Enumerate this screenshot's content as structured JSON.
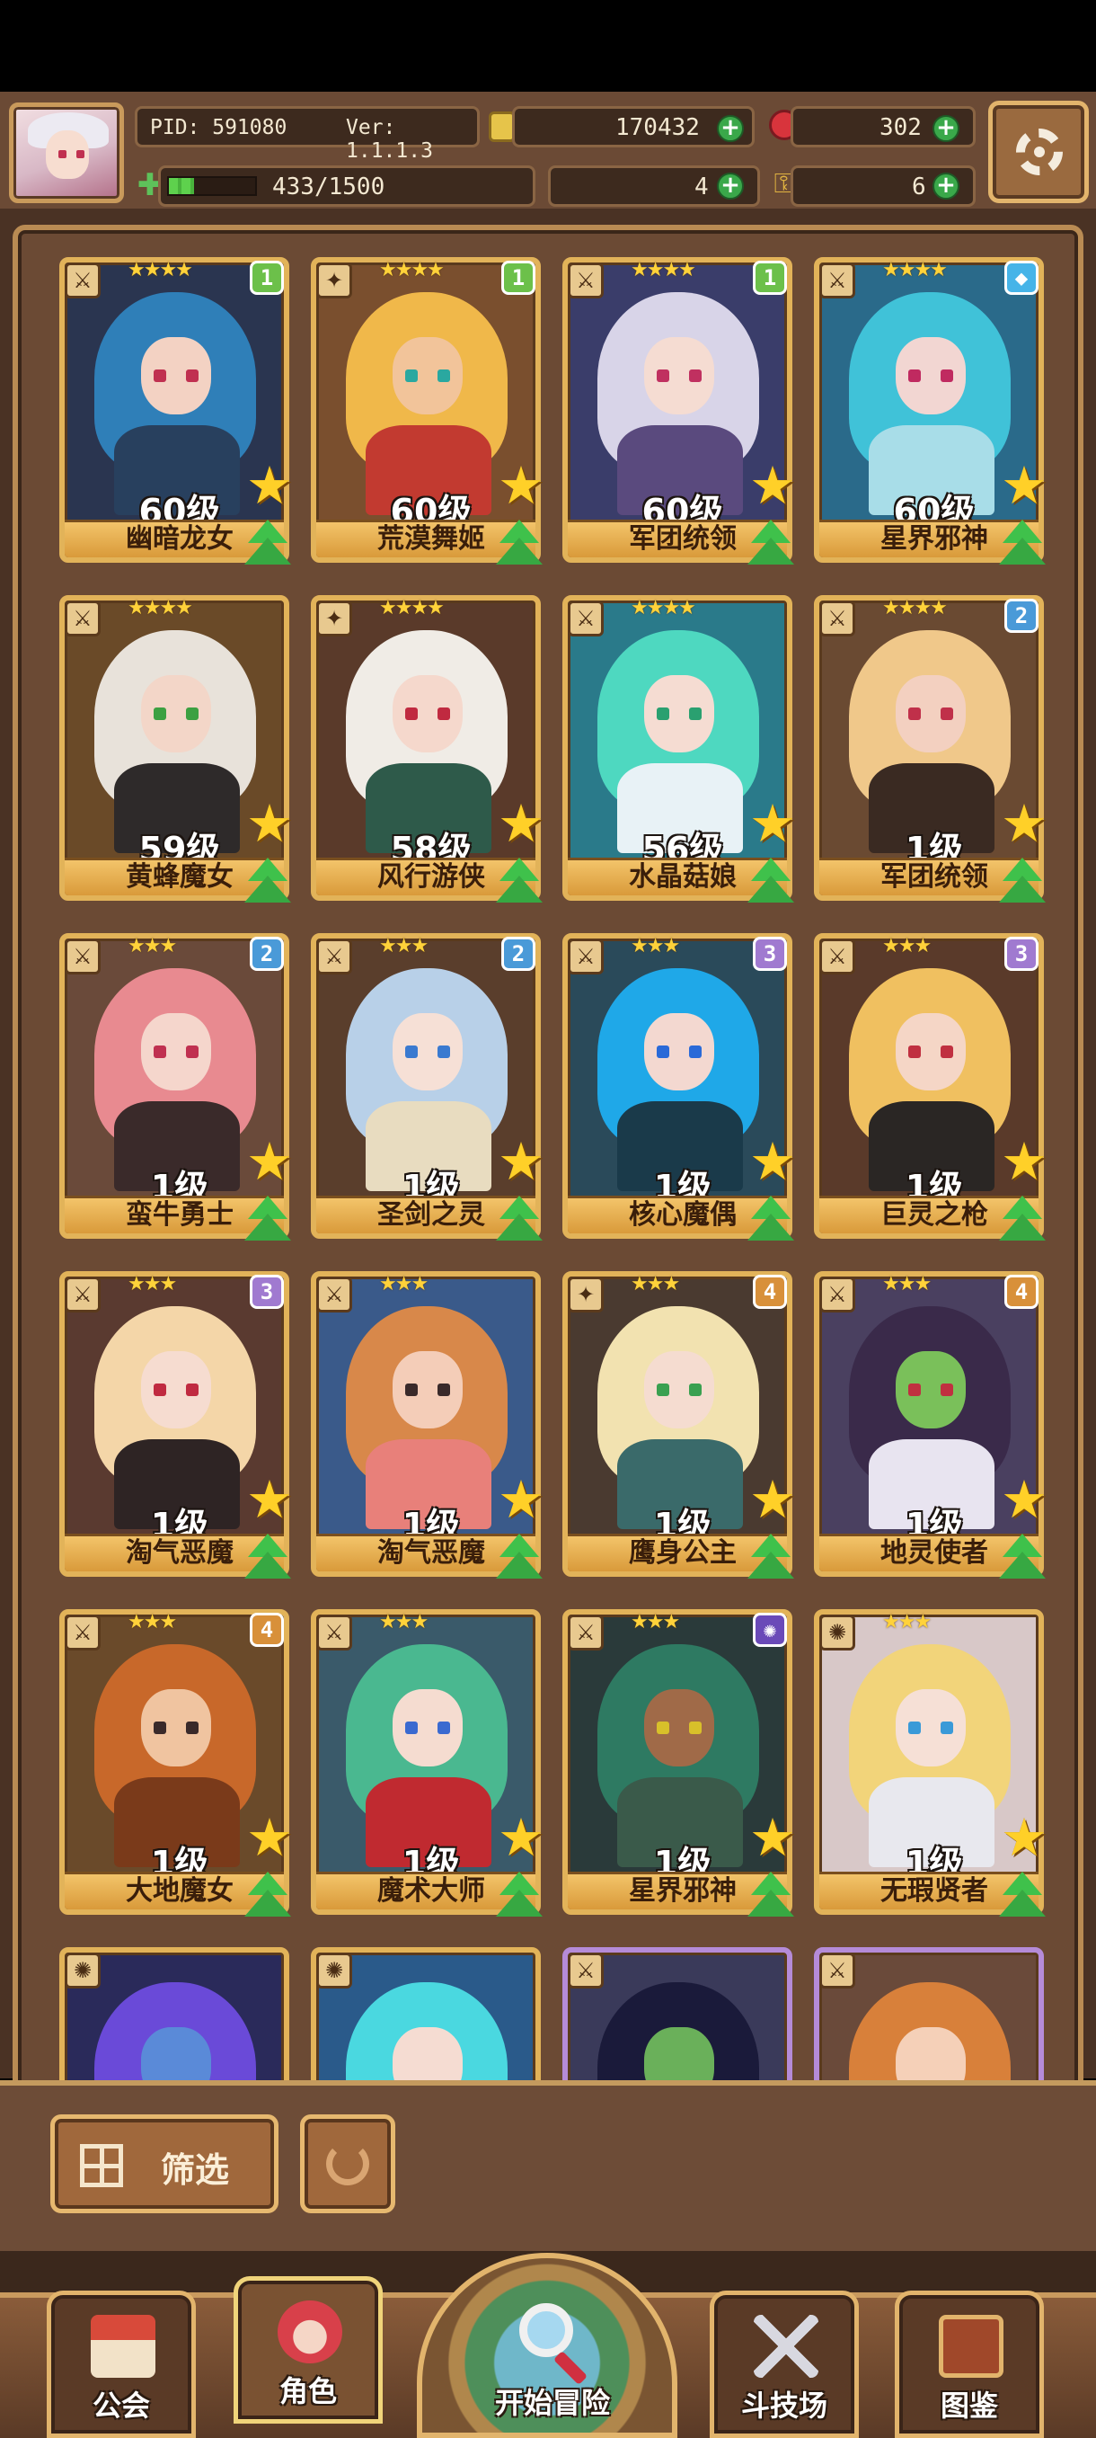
{
  "header": {
    "pid": "PID: 591080",
    "version": "Ver: 1.1.1.3",
    "gold": "170432",
    "gems": "302",
    "energy": "433/1500",
    "energy_fraction": 0.289,
    "clovers": "4",
    "keys": "6"
  },
  "cards": [
    {
      "level": "60级",
      "name": "幽暗龙女",
      "stars": "★★★★",
      "rank": "1",
      "rank_color": "#6cc04a",
      "type": "⚔",
      "hair": "#2f7fb8",
      "skin": "#f3d2c3",
      "bg": "#2a3550",
      "eye": "#c03050",
      "outfit": "#28405e"
    },
    {
      "level": "60级",
      "name": "荒漠舞姬",
      "stars": "★★★★",
      "rank": "1",
      "rank_color": "#6cc04a",
      "type": "✦",
      "hair": "#f0b84a",
      "skin": "#f2c49a",
      "bg": "#7a4f2e",
      "eye": "#2aa8a0",
      "outfit": "#c23a30"
    },
    {
      "level": "60级",
      "name": "军团统领",
      "stars": "★★★★",
      "rank": "1",
      "rank_color": "#6cc04a",
      "type": "⚔",
      "hair": "#d8d4e8",
      "skin": "#f5dcd2",
      "bg": "#3a3d6a",
      "eye": "#c03060",
      "outfit": "#5a4a7e"
    },
    {
      "level": "60级",
      "name": "星界邪神",
      "stars": "★★★★",
      "rank": "◆",
      "rank_color": "#46b4e8",
      "type": "⚔",
      "hair": "#40c2d8",
      "skin": "#f2d6d2",
      "bg": "#2a6a8a",
      "eye": "#c02a60",
      "outfit": "#a8dde8"
    },
    {
      "level": "59级",
      "name": "黄蜂魔女",
      "stars": "★★★★",
      "rank": "",
      "rank_color": "",
      "type": "⚔",
      "hair": "#e8e2da",
      "skin": "#f3d6c8",
      "bg": "#6a4a28",
      "eye": "#3ca042",
      "outfit": "#2e2a2a"
    },
    {
      "level": "58级",
      "name": "风行游侠",
      "stars": "★★★★",
      "rank": "",
      "rank_color": "",
      "type": "✦",
      "hair": "#f0ece6",
      "skin": "#f5d8cc",
      "bg": "#5a3a2a",
      "eye": "#c02a40",
      "outfit": "#2e5a4a"
    },
    {
      "level": "56级",
      "name": "水晶菇娘",
      "stars": "★★★★",
      "rank": "",
      "rank_color": "",
      "type": "⚔",
      "hair": "#4ed8c0",
      "skin": "#f5dcd2",
      "bg": "#2a7a8a",
      "eye": "#2aa070",
      "outfit": "#e8f2f6"
    },
    {
      "level": "1级",
      "name": "军团统领",
      "stars": "★★★★",
      "rank": "2",
      "rank_color": "#4a9ad8",
      "type": "⚔",
      "hair": "#f0c88a",
      "skin": "#f3d0c0",
      "bg": "#6a4a32",
      "eye": "#c0304a",
      "outfit": "#3a2a22"
    },
    {
      "level": "1级",
      "name": "蛮牛勇士",
      "stars": "★★★",
      "rank": "2",
      "rank_color": "#4a9ad8",
      "type": "⚔",
      "hair": "#e88a90",
      "skin": "#f5d6cc",
      "bg": "#6a4a3a",
      "eye": "#c03050",
      "outfit": "#3a2a2a"
    },
    {
      "level": "1级",
      "name": "圣剑之灵",
      "stars": "★★★",
      "rank": "2",
      "rank_color": "#4a9ad8",
      "type": "⚔",
      "hair": "#b8d0e8",
      "skin": "#f6e0d6",
      "bg": "#5a3e2c",
      "eye": "#3a7ad0",
      "outfit": "#e8dcc0"
    },
    {
      "level": "1级",
      "name": "核心魔偶",
      "stars": "★★★",
      "rank": "3",
      "rank_color": "#a07ad0",
      "type": "⚔",
      "hair": "#1fa8e8",
      "skin": "#f3d8d0",
      "bg": "#2a4a5a",
      "eye": "#2a6ad8",
      "outfit": "#1a3a4a"
    },
    {
      "level": "1级",
      "name": "巨灵之枪",
      "stars": "★★★",
      "rank": "3",
      "rank_color": "#a07ad0",
      "type": "⚔",
      "hair": "#f0c060",
      "skin": "#f5d6c6",
      "bg": "#5a3a2a",
      "eye": "#c03040",
      "outfit": "#2a2624"
    },
    {
      "level": "1级",
      "name": "淘气恶魔",
      "stars": "★★★",
      "rank": "3",
      "rank_color": "#a07ad0",
      "type": "⚔",
      "hair": "#f4d6a8",
      "skin": "#f6dcd0",
      "bg": "#5a3a30",
      "eye": "#c02a40",
      "outfit": "#2e2424"
    },
    {
      "level": "1级",
      "name": "淘气恶魔",
      "stars": "★★★",
      "rank": "",
      "rank_color": "",
      "type": "⚔",
      "hair": "#d8884a",
      "skin": "#f4cdb8",
      "bg": "#3a5a8a",
      "eye": "#3a2a2a",
      "outfit": "#e8807a"
    },
    {
      "level": "1级",
      "name": "鹰身公主",
      "stars": "★★★",
      "rank": "4",
      "rank_color": "#d8903a",
      "type": "✦",
      "hair": "#f2e2b0",
      "skin": "#f5dcd0",
      "bg": "#4a3a30",
      "eye": "#3aa050",
      "outfit": "#3a6a6a"
    },
    {
      "level": "1级",
      "name": "地灵使者",
      "stars": "★★★",
      "rank": "4",
      "rank_color": "#d8903a",
      "type": "⚔",
      "hair": "#3a2a4a",
      "skin": "#7ac05a",
      "bg": "#4a4060",
      "eye": "#c03040",
      "outfit": "#e8e4f0"
    },
    {
      "level": "1级",
      "name": "大地魔女",
      "stars": "★★★",
      "rank": "4",
      "rank_color": "#d8903a",
      "type": "⚔",
      "hair": "#c8682a",
      "skin": "#f0c4a0",
      "bg": "#6a4a2a",
      "eye": "#3a2a2a",
      "outfit": "#7a3a1a"
    },
    {
      "level": "1级",
      "name": "魔术大师",
      "stars": "★★★",
      "rank": "",
      "rank_color": "",
      "type": "⚔",
      "hair": "#4ab890",
      "skin": "#f5dcd0",
      "bg": "#3a5a6a",
      "eye": "#3a6ad0",
      "outfit": "#c02a30"
    },
    {
      "level": "1级",
      "name": "星界邪神",
      "stars": "★★★",
      "rank": "✺",
      "rank_color": "#6a4ab8",
      "type": "⚔",
      "hair": "#2e7a62",
      "skin": "#a06a48",
      "bg": "#2a3a3a",
      "eye": "#d8c02a",
      "outfit": "#3a5a4a"
    },
    {
      "level": "1级",
      "name": "无瑕贤者",
      "stars": "★★★",
      "rank": "",
      "rank_color": "",
      "type": "✺",
      "hair": "#f2d47a",
      "skin": "#f6e0d6",
      "bg": "#d8c8c8",
      "eye": "#3a9ad8",
      "outfit": "#e8e8ee"
    }
  ],
  "partial_cards": [
    {
      "type": "✺",
      "hair": "#6a4ad8",
      "skin": "#5a8ad8",
      "bg": "#2a2a5a",
      "purple": false
    },
    {
      "type": "✺",
      "hair": "#4ad8e0",
      "skin": "#f5dcd2",
      "bg": "#2a5a8a",
      "purple": false
    },
    {
      "type": "⚔",
      "hair": "#1a1a3a",
      "skin": "#6ab05a",
      "bg": "#3a3a5a",
      "purple": true
    },
    {
      "type": "⚔",
      "hair": "#d8803a",
      "skin": "#f5d0b8",
      "bg": "#6a4a3a",
      "purple": true
    }
  ],
  "controls": {
    "filter_label": "筛选"
  },
  "nav": {
    "guild": "公会",
    "character": "角色",
    "adventure": "开始冒险",
    "arena": "斗技场",
    "codex": "图鉴"
  }
}
